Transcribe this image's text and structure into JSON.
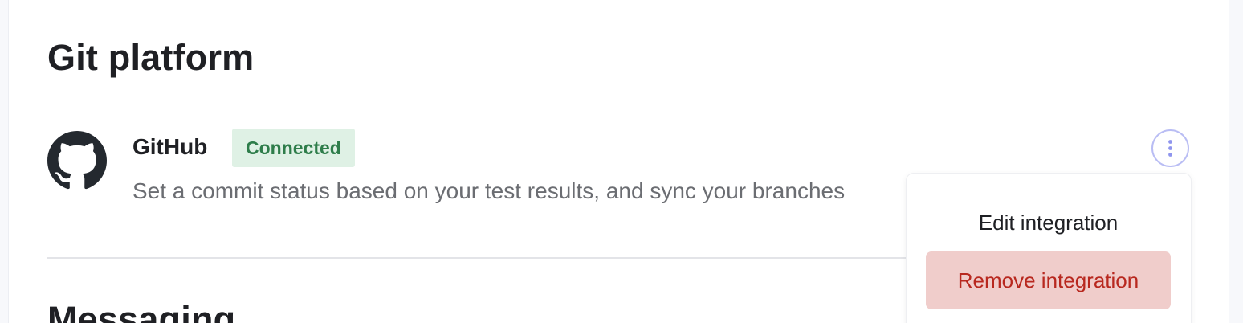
{
  "sections": {
    "git_platform_title": "Git platform",
    "messaging_title": "Messaging"
  },
  "integration": {
    "name": "GitHub",
    "status": "Connected",
    "description": "Set a commit status based on your test results, and sync your branches",
    "logo_icon": "github-icon"
  },
  "actions": {
    "more_icon": "more-vertical-icon"
  },
  "menu": {
    "edit_label": "Edit integration",
    "remove_label": "Remove integration"
  },
  "colors": {
    "badge_background": "#dff1e5",
    "badge_text": "#2e7d4a",
    "danger_background": "#f0cdcb",
    "danger_text": "#b8281f",
    "accent": "#8f95ee"
  }
}
